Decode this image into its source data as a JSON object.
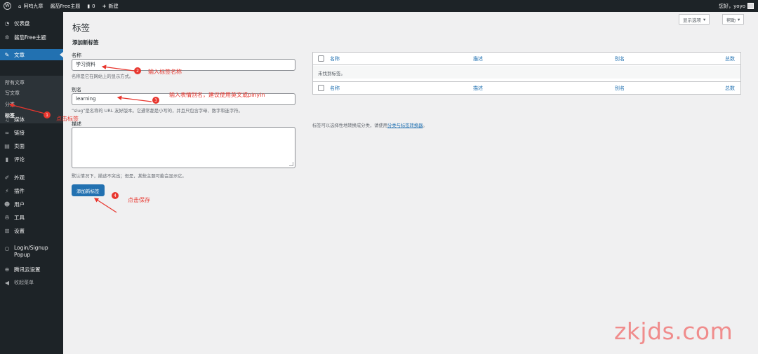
{
  "adminbar": {
    "site_name": "阿呜九章",
    "theme_name": "酱茄Free主题",
    "comments_count": "0",
    "new_label": "新建",
    "greeting": "您好，yoyo"
  },
  "sidebar": {
    "dashboard": "仪表盘",
    "theme": "酱茄Free主题",
    "posts": "文章",
    "sub_all_posts": "所有文章",
    "sub_write": "写文章",
    "sub_categories": "分类",
    "sub_tags": "标签",
    "media": "媒体",
    "links": "链接",
    "pages": "页面",
    "comments": "评论",
    "appearance": "外观",
    "plugins": "插件",
    "users": "用户",
    "tools": "工具",
    "settings": "设置",
    "login_popup_line1": "Login/Signup",
    "login_popup_line2": "Popup",
    "tencent_cloud": "腾讯云设置",
    "collapse": "收起菜单"
  },
  "header": {
    "screen_options": "显示选项",
    "help": "帮助"
  },
  "page": {
    "title": "标签",
    "add_section_title": "添加新标签"
  },
  "form": {
    "name_label": "名称",
    "name_value": "学习资料",
    "name_help": "名称是它在网站上的显示方式。",
    "slug_label": "别名",
    "slug_value": "learning",
    "slug_help": "“slug”是名称的 URL 友好版本。它通常都是小写的，并且只包含字母、数字和连字符。",
    "desc_label": "描述",
    "desc_value": "",
    "desc_help": "默认情况下，描述不突出；但是，某些主题可能会显示它。",
    "submit_label": "添加新标签"
  },
  "table": {
    "columns": [
      "名称",
      "描述",
      "别名",
      "总数"
    ],
    "empty_message": "未找到标签。",
    "note_prefix": "标签可以选择性地转换成分类，请使用",
    "note_link": "分类与标签转换器",
    "note_suffix": "。"
  },
  "annotations": {
    "step1": "点击标签",
    "step2": "输入标签名称",
    "step3": "输入表情别名，建议使用英文或pinyin",
    "step4": "点击保存",
    "badge1": "1",
    "badge2": "2",
    "badge3": "3",
    "badge4": "4",
    "color": "#e8362e"
  },
  "watermark": "zkjds.com",
  "colors": {
    "admin_dark": "#1d2327",
    "accent_blue": "#2271b1",
    "background": "#f0f0f1"
  }
}
